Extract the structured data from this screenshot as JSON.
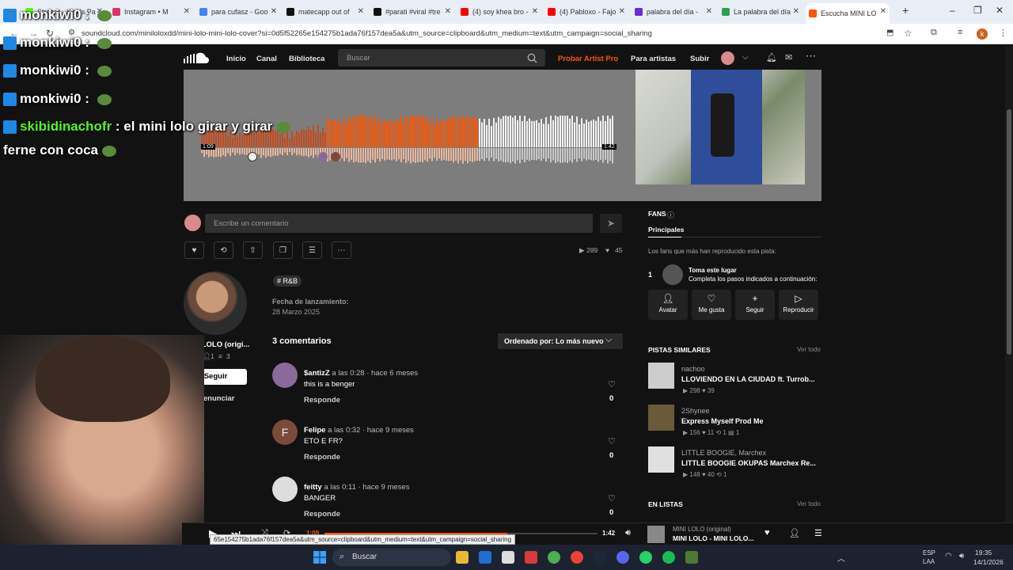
{
  "browser": {
    "tabs": [
      {
        "label": "Stream - Kick's Pa",
        "color": "#53fc18"
      },
      {
        "label": "Instagram • M",
        "color": "#e1306c"
      },
      {
        "label": "para cufasz - Goo",
        "color": "#4285f4"
      },
      {
        "label": "matecapp out of",
        "color": "#111111"
      },
      {
        "label": "#parati #viral #tre",
        "color": "#111111"
      },
      {
        "label": "(4) soy khea bro -",
        "color": "#ff0000"
      },
      {
        "label": "(4) Pabloxo - Fajo",
        "color": "#ff0000"
      },
      {
        "label": "palabra del día -",
        "color": "#6a2bd9"
      },
      {
        "label": "La palabra del día",
        "color": "#2e9e4f"
      },
      {
        "label": "Escucha MINI LO",
        "color": "#ff5500"
      }
    ],
    "url": "soundcloud.com/miniloloxdd/mini-lolo-mini-lolo-cover?si=0d5f52265e154275b1ada76f157dea5a&utm_source=clipboard&utm_medium=text&utm_campaign=social_sharing",
    "status_url": "65e154275b1ada76f157dea5a&utm_source=clipboard&utm_medium=text&utm_campaign=social_sharing",
    "profile_initial": "k"
  },
  "header": {
    "home": "Inicio",
    "feed": "Canal",
    "library": "Biblioteca",
    "search_placeholder": "Buscar",
    "artist_pro": "Probar Artist Pro",
    "for_artists": "Para artistas",
    "upload": "Subir"
  },
  "waveform": {
    "current_time": "1:09",
    "duration": "1:42",
    "progress": 0.67
  },
  "comment_box": {
    "placeholder": "Escribe un comentario"
  },
  "stats": {
    "plays": "289",
    "likes": "45"
  },
  "artist": {
    "name": "MINI LOLO (origi...",
    "followers": "1",
    "tracks": "3",
    "follow_label": "Seguir",
    "report_label": "Denunciar"
  },
  "track": {
    "tag": "# R&B",
    "release_label": "Fecha de lanzamiento:",
    "release_date": "28 Marzo 2025"
  },
  "comments": {
    "count_label": "3 comentarios",
    "sort_label": "Ordenado por: Lo más nuevo",
    "items": [
      {
        "user": "$antizZ",
        "at": "a las",
        "time": "0:28",
        "ago": "· hace 6 meses",
        "text": "this is a benger",
        "reply": "Responde",
        "likes": "0",
        "avatar_color": "#8a6a9a"
      },
      {
        "user": "Felipe",
        "at": "a las",
        "time": "0:32",
        "ago": "· hace 9 meses",
        "text": "ETO E FR?",
        "reply": "Responde",
        "likes": "0",
        "avatar_color": "#7a4a3a",
        "initial": "F"
      },
      {
        "user": "feitty",
        "at": "a las",
        "time": "0:11",
        "ago": "· hace 9 meses",
        "text": "BANGER",
        "reply": "Responde",
        "likes": "0",
        "avatar_color": "#dddddd"
      }
    ]
  },
  "fans": {
    "title": "FANS",
    "tab": "Principales",
    "desc": "Los fans que más han reproducido esta pista:",
    "rank": "1",
    "slot_title": "Toma este lugar",
    "slot_desc": "Completa los pasos indicados a continuación:",
    "steps": [
      "Avatar",
      "Me gusta",
      "Seguir",
      "Reproducir"
    ]
  },
  "similar": {
    "title": "PISTAS SIMILARES",
    "view_all": "Ver todo",
    "tracks": [
      {
        "artist": "nachoo",
        "name": "LLOVIENDO EN LA CIUDAD ft. Turrob...",
        "plays": "298",
        "likes": "39",
        "reposts": "",
        "comments": "",
        "color": "#cccccc"
      },
      {
        "artist": "2Shynee",
        "name": "Express Myself Prod Me",
        "plays": "156",
        "likes": "11",
        "reposts": "1",
        "comments": "1",
        "color": "#6a5a3a"
      },
      {
        "artist": "LITTLE BOOGIE, Marchex",
        "name": "LITTLE BOOGIE OKUPAS Marchex Re...",
        "plays": "148",
        "likes": "40",
        "reposts": "1",
        "comments": "",
        "color": "#e0e0e0"
      }
    ]
  },
  "playlists": {
    "title": "EN LISTAS",
    "view_all": "Ver todo"
  },
  "player": {
    "current": "1:09",
    "duration": "1:42",
    "artist": "MINI LOLO (original)",
    "title": "MINI LOLO - MINI LOLO..."
  },
  "chat": [
    {
      "user": "monkiwi0",
      "sep": ":",
      "msg": "",
      "color": "#ffffff"
    },
    {
      "user": "monkiwi0",
      "sep": ":",
      "msg": "",
      "color": "#ffffff"
    },
    {
      "user": "monkiwi0",
      "sep": ":",
      "msg": "",
      "color": "#ffffff"
    },
    {
      "user": "monkiwi0",
      "sep": ":",
      "msg": "",
      "color": "#ffffff"
    },
    {
      "user": "skibidinachofr",
      "sep": ":",
      "msg": "el mini lolo girar y girar",
      "color": "#53fc18"
    },
    {
      "user": "",
      "sep": "",
      "msg": "ferne con coca",
      "color": "#ffffff"
    }
  ],
  "taskbar": {
    "search": "Buscar",
    "lang1": "ESP",
    "lang2": "LAA",
    "time": "19:35",
    "date": "14/1/2026"
  }
}
